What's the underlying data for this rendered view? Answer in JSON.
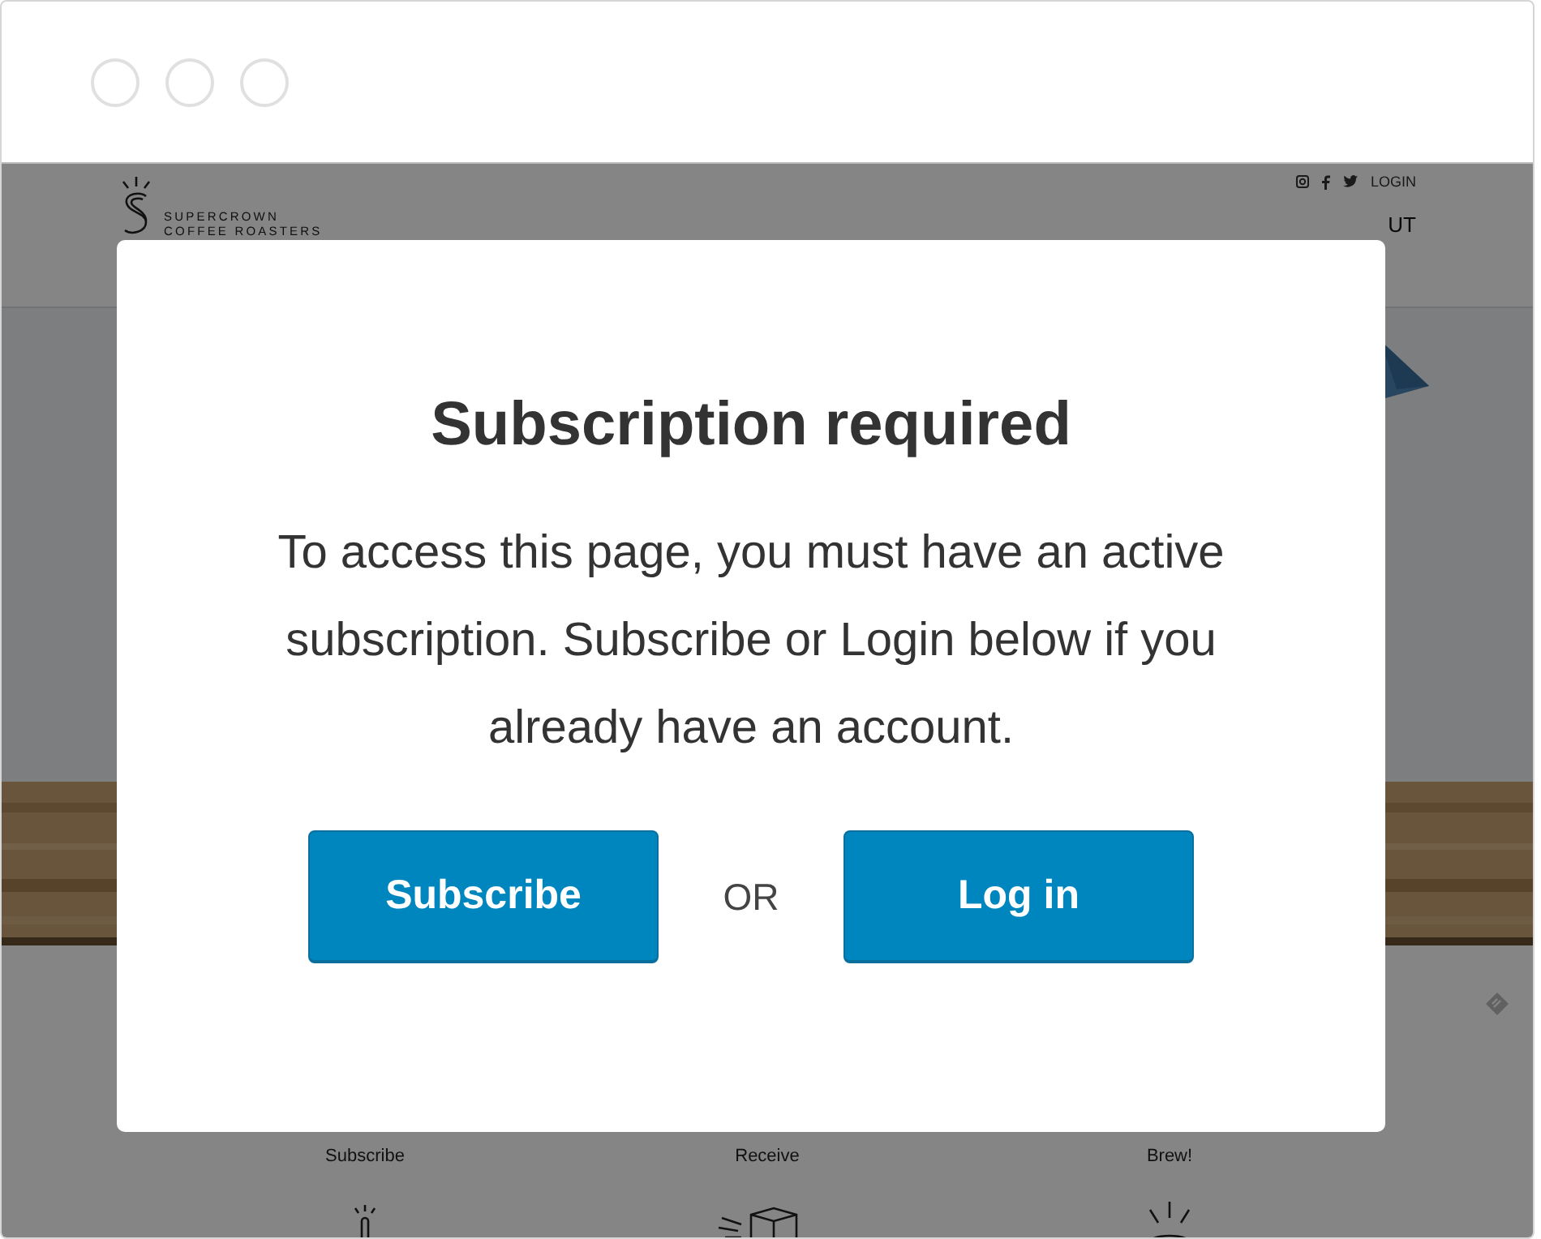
{
  "site": {
    "logo_lines": [
      "SUPERCROWN",
      "COFFEE ROASTERS"
    ],
    "top_links": [
      {
        "kind": "instagram"
      },
      {
        "kind": "facebook"
      },
      {
        "kind": "twitter"
      },
      {
        "kind": "text",
        "label": "LOGIN"
      }
    ],
    "nav_partial": "UT",
    "hero": {
      "kind": "picture"
    },
    "steps": [
      {
        "label": "Subscribe",
        "kind": "hand"
      },
      {
        "label": "Receive",
        "kind": "box"
      },
      {
        "label": "Brew!",
        "kind": "cup"
      }
    ]
  },
  "modal": {
    "title": "Subscription required",
    "message": "To access this page, you must have an active subscription. Subscribe or Login below if you already have an account.",
    "buttons": [
      {
        "label": "Subscribe"
      },
      {
        "label": "Log in"
      }
    ],
    "separator": "OR"
  }
}
